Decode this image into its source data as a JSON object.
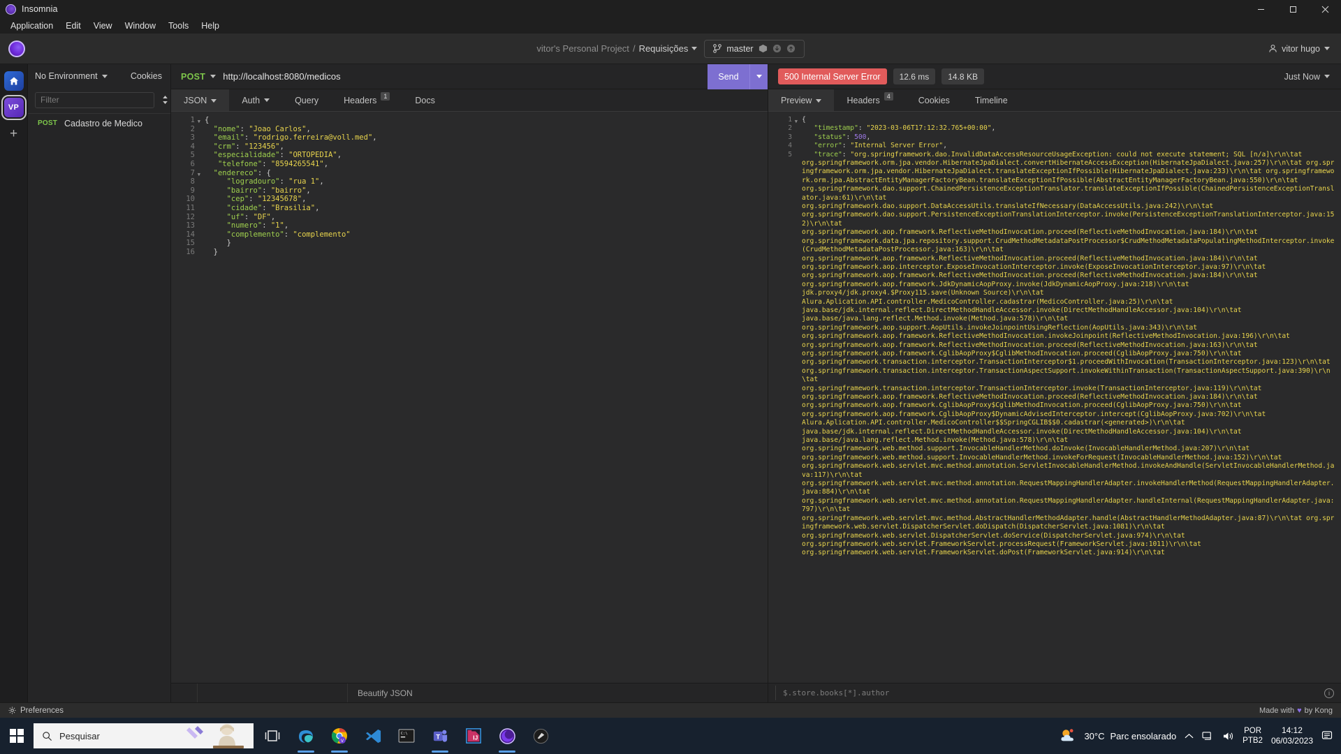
{
  "window": {
    "app_title": "Insomnia",
    "minimize": "─",
    "maximize": "☐",
    "close": "✕"
  },
  "menubar": {
    "items": [
      "Application",
      "Edit",
      "View",
      "Window",
      "Tools",
      "Help"
    ]
  },
  "header": {
    "project_owner": "vitor's Personal Project",
    "separator": "/",
    "workspace": "Requisições",
    "branch": "master",
    "user": "vitor hugo"
  },
  "sidebar": {
    "environment": "No Environment",
    "cookies": "Cookies",
    "filter_placeholder": "Filter",
    "requests": [
      {
        "method": "POST",
        "name": "Cadastro de Medico"
      }
    ],
    "workspace_initials": "VP"
  },
  "request": {
    "method": "POST",
    "url": "http://localhost:8080/medicos",
    "send_label": "Send",
    "tabs": [
      {
        "label": "JSON",
        "dropdown": true,
        "badge": "",
        "active": true
      },
      {
        "label": "Auth",
        "dropdown": true,
        "badge": "",
        "active": false
      },
      {
        "label": "Query",
        "dropdown": false,
        "badge": "",
        "active": false
      },
      {
        "label": "Headers",
        "dropdown": false,
        "badge": "1",
        "active": false
      },
      {
        "label": "Docs",
        "dropdown": false,
        "badge": "",
        "active": false
      }
    ],
    "beautify_label": "Beautify JSON",
    "body_lines": [
      {
        "n": 1,
        "fold": true,
        "html": "<span class=\"p\">{</span>"
      },
      {
        "n": 2,
        "fold": false,
        "html": "  <span class=\"k\">\"nome\"</span><span class=\"p\">: </span><span class=\"s\">\"Joao Carlos\"</span><span class=\"p\">,</span>"
      },
      {
        "n": 3,
        "fold": false,
        "html": "  <span class=\"k\">\"email\"</span><span class=\"p\">: </span><span class=\"s\">\"rodrigo.ferreira@voll.med\"</span><span class=\"p\">,</span>"
      },
      {
        "n": 4,
        "fold": false,
        "html": "  <span class=\"k\">\"crm\"</span><span class=\"p\">: </span><span class=\"s\">\"123456\"</span><span class=\"p\">,</span>"
      },
      {
        "n": 5,
        "fold": false,
        "html": "  <span class=\"k\">\"especialidade\"</span><span class=\"p\">: </span><span class=\"s\">\"ORTOPEDIA\"</span><span class=\"p\">,</span>"
      },
      {
        "n": 6,
        "fold": false,
        "html": "   <span class=\"k\">\"telefone\"</span><span class=\"p\">: </span><span class=\"s\">\"8594265541\"</span><span class=\"p\">,</span>"
      },
      {
        "n": 7,
        "fold": true,
        "html": "  <span class=\"k\">\"endereco\"</span><span class=\"p\">: {</span>"
      },
      {
        "n": 8,
        "fold": false,
        "html": "     <span class=\"k\">\"logradouro\"</span><span class=\"p\">: </span><span class=\"s\">\"rua 1\"</span><span class=\"p\">,</span>"
      },
      {
        "n": 9,
        "fold": false,
        "html": "     <span class=\"k\">\"bairro\"</span><span class=\"p\">: </span><span class=\"s\">\"bairro\"</span><span class=\"p\">,</span>"
      },
      {
        "n": 10,
        "fold": false,
        "html": "     <span class=\"k\">\"cep\"</span><span class=\"p\">: </span><span class=\"s\">\"12345678\"</span><span class=\"p\">,</span>"
      },
      {
        "n": 11,
        "fold": false,
        "html": "     <span class=\"k\">\"cidade\"</span><span class=\"p\">: </span><span class=\"s\">\"Brasilia\"</span><span class=\"p\">,</span>"
      },
      {
        "n": 12,
        "fold": false,
        "html": "     <span class=\"k\">\"uf\"</span><span class=\"p\">: </span><span class=\"s\">\"DF\"</span><span class=\"p\">,</span>"
      },
      {
        "n": 13,
        "fold": false,
        "html": "     <span class=\"k\">\"numero\"</span><span class=\"p\">: </span><span class=\"s\">\"1\"</span><span class=\"p\">,</span>"
      },
      {
        "n": 14,
        "fold": false,
        "html": "     <span class=\"k\">\"complemento\"</span><span class=\"p\">: </span><span class=\"s\">\"complemento\"</span>"
      },
      {
        "n": 15,
        "fold": false,
        "html": "     <span class=\"p\">}</span>"
      },
      {
        "n": 16,
        "fold": false,
        "html": "  <span class=\"p\">}</span>"
      }
    ],
    "body_text": "{\n  \"nome\": \"Joao Carlos\",\n  \"email\": \"rodrigo.ferreira@voll.med\",\n  \"crm\": \"123456\",\n  \"especialidade\": \"ORTOPEDIA\",\n   \"telefone\": \"8594265541\",\n  \"endereco\": {\n     \"logradouro\": \"rua 1\",\n     \"bairro\": \"bairro\",\n     \"cep\": \"12345678\",\n     \"cidade\": \"Brasilia\",\n     \"uf\": \"DF\",\n     \"numero\": \"1\",\n     \"complemento\": \"complemento\"\n     }\n  }"
  },
  "response": {
    "status_code": "500 Internal Server Error",
    "time": "12.6 ms",
    "size": "14.8 KB",
    "when": "Just Now",
    "tabs": [
      {
        "label": "Preview",
        "dropdown": true,
        "badge": "",
        "active": true
      },
      {
        "label": "Headers",
        "dropdown": false,
        "badge": "4",
        "active": false
      },
      {
        "label": "Cookies",
        "dropdown": false,
        "badge": "",
        "active": false
      },
      {
        "label": "Timeline",
        "dropdown": false,
        "badge": "",
        "active": false
      }
    ],
    "jsonpath_placeholder": "$.store.books[*].author",
    "body_head": [
      {
        "n": 1,
        "fold": true,
        "html": "<span class=\"p\">{</span>"
      },
      {
        "n": 2,
        "fold": false,
        "html": "   <span class=\"k\">\"timestamp\"</span><span class=\"p\">: </span><span class=\"s\">\"2023-03-06T17:12:32.765+00:00\"</span><span class=\"p\">,</span>"
      },
      {
        "n": 3,
        "fold": false,
        "html": "   <span class=\"k\">\"status\"</span><span class=\"p\">: </span><span class=\"n\">500</span><span class=\"p\">,</span>"
      },
      {
        "n": 4,
        "fold": false,
        "html": "   <span class=\"k\">\"error\"</span><span class=\"p\">: </span><span class=\"s\">\"Internal Server Error\"</span><span class=\"p\">,</span>"
      }
    ],
    "trace_prefix_key": "\"trace\"",
    "trace_value_open": "\"org.springframework.dao.InvalidDataAccessResourceUsageException: could not execute statement; SQL [n/a]\\r\\n\\tat ",
    "trace_lines": [
      "org.springframework.orm.jpa.vendor.HibernateJpaDialect.convertHibernateAccessException(HibernateJpaDialect.java:257)\\r\\n\\tat org.springframework.orm.jpa.vendor.HibernateJpaDialect.translateExceptionIfPossible(HibernateJpaDialect.java:233)\\r\\n\\tat org.springframework.orm.jpa.AbstractEntityManagerFactoryBean.translateExceptionIfPossible(AbstractEntityManagerFactoryBean.java:550)\\r\\n\\tat",
      "org.springframework.dao.support.ChainedPersistenceExceptionTranslator.translateExceptionIfPossible(ChainedPersistenceExceptionTranslator.java:61)\\r\\n\\tat",
      "org.springframework.dao.support.DataAccessUtils.translateIfNecessary(DataAccessUtils.java:242)\\r\\n\\tat",
      "org.springframework.dao.support.PersistenceExceptionTranslationInterceptor.invoke(PersistenceExceptionTranslationInterceptor.java:152)\\r\\n\\tat",
      "org.springframework.aop.framework.ReflectiveMethodInvocation.proceed(ReflectiveMethodInvocation.java:184)\\r\\n\\tat",
      "org.springframework.data.jpa.repository.support.CrudMethodMetadataPostProcessor$CrudMethodMetadataPopulatingMethodInterceptor.invoke(CrudMethodMetadataPostProcessor.java:163)\\r\\n\\tat",
      "org.springframework.aop.framework.ReflectiveMethodInvocation.proceed(ReflectiveMethodInvocation.java:184)\\r\\n\\tat",
      "org.springframework.aop.interceptor.ExposeInvocationInterceptor.invoke(ExposeInvocationInterceptor.java:97)\\r\\n\\tat",
      "org.springframework.aop.framework.ReflectiveMethodInvocation.proceed(ReflectiveMethodInvocation.java:184)\\r\\n\\tat",
      "org.springframework.aop.framework.JdkDynamicAopProxy.invoke(JdkDynamicAopProxy.java:218)\\r\\n\\tat",
      "jdk.proxy4/jdk.proxy4.$Proxy115.save(Unknown Source)\\r\\n\\tat",
      "Alura.Aplication.API.controller.MedicoController.cadastrar(MedicoController.java:25)\\r\\n\\tat",
      "java.base/jdk.internal.reflect.DirectMethodHandleAccessor.invoke(DirectMethodHandleAccessor.java:104)\\r\\n\\tat",
      "java.base/java.lang.reflect.Method.invoke(Method.java:578)\\r\\n\\tat",
      "org.springframework.aop.support.AopUtils.invokeJoinpointUsingReflection(AopUtils.java:343)\\r\\n\\tat",
      "org.springframework.aop.framework.ReflectiveMethodInvocation.invokeJoinpoint(ReflectiveMethodInvocation.java:196)\\r\\n\\tat",
      "org.springframework.aop.framework.ReflectiveMethodInvocation.proceed(ReflectiveMethodInvocation.java:163)\\r\\n\\tat",
      "org.springframework.aop.framework.CglibAopProxy$CglibMethodInvocation.proceed(CglibAopProxy.java:750)\\r\\n\\tat",
      "org.springframework.transaction.interceptor.TransactionInterceptor$1.proceedWithInvocation(TransactionInterceptor.java:123)\\r\\n\\tat",
      "org.springframework.transaction.interceptor.TransactionAspectSupport.invokeWithinTransaction(TransactionAspectSupport.java:390)\\r\\n\\tat",
      "org.springframework.transaction.interceptor.TransactionInterceptor.invoke(TransactionInterceptor.java:119)\\r\\n\\tat",
      "org.springframework.aop.framework.ReflectiveMethodInvocation.proceed(ReflectiveMethodInvocation.java:184)\\r\\n\\tat",
      "org.springframework.aop.framework.CglibAopProxy$CglibMethodInvocation.proceed(CglibAopProxy.java:750)\\r\\n\\tat",
      "org.springframework.aop.framework.CglibAopProxy$DynamicAdvisedInterceptor.intercept(CglibAopProxy.java:702)\\r\\n\\tat",
      "Alura.Aplication.API.controller.MedicoController$$SpringCGLIB$$0.cadastrar(<generated>)\\r\\n\\tat",
      "java.base/jdk.internal.reflect.DirectMethodHandleAccessor.invoke(DirectMethodHandleAccessor.java:104)\\r\\n\\tat",
      "java.base/java.lang.reflect.Method.invoke(Method.java:578)\\r\\n\\tat",
      "org.springframework.web.method.support.InvocableHandlerMethod.doInvoke(InvocableHandlerMethod.java:207)\\r\\n\\tat",
      "org.springframework.web.method.support.InvocableHandlerMethod.invokeForRequest(InvocableHandlerMethod.java:152)\\r\\n\\tat",
      "org.springframework.web.servlet.mvc.method.annotation.ServletInvocableHandlerMethod.invokeAndHandle(ServletInvocableHandlerMethod.java:117)\\r\\n\\tat",
      "org.springframework.web.servlet.mvc.method.annotation.RequestMappingHandlerAdapter.invokeHandlerMethod(RequestMappingHandlerAdapter.java:884)\\r\\n\\tat",
      "org.springframework.web.servlet.mvc.method.annotation.RequestMappingHandlerAdapter.handleInternal(RequestMappingHandlerAdapter.java:797)\\r\\n\\tat",
      "org.springframework.web.servlet.mvc.method.AbstractHandlerMethodAdapter.handle(AbstractHandlerMethodAdapter.java:87)\\r\\n\\tat org.springframework.web.servlet.DispatcherServlet.doDispatch(DispatcherServlet.java:1081)\\r\\n\\tat",
      "org.springframework.web.servlet.DispatcherServlet.doService(DispatcherServlet.java:974)\\r\\n\\tat",
      "org.springframework.web.servlet.FrameworkServlet.processRequest(FrameworkServlet.java:1011)\\r\\n\\tat",
      "org.springframework.web.servlet.FrameworkServlet.doPost(FrameworkServlet.java:914)\\r\\n\\tat"
    ]
  },
  "footer": {
    "preferences": "Preferences",
    "made_with_pre": "Made with",
    "made_with_heart": "♥",
    "made_with_post": "by Kong"
  },
  "taskbar": {
    "search_placeholder": "Pesquisar",
    "weather_temp": "30°C",
    "weather_desc": "Parc ensolarado",
    "lang_line1": "POR",
    "lang_line2": "PTB2",
    "time": "14:12",
    "date": "06/03/2023",
    "apps": [
      "task-view",
      "edge",
      "chrome",
      "vscode",
      "terminal",
      "teams",
      "intellij",
      "insomnia",
      "postman"
    ]
  }
}
